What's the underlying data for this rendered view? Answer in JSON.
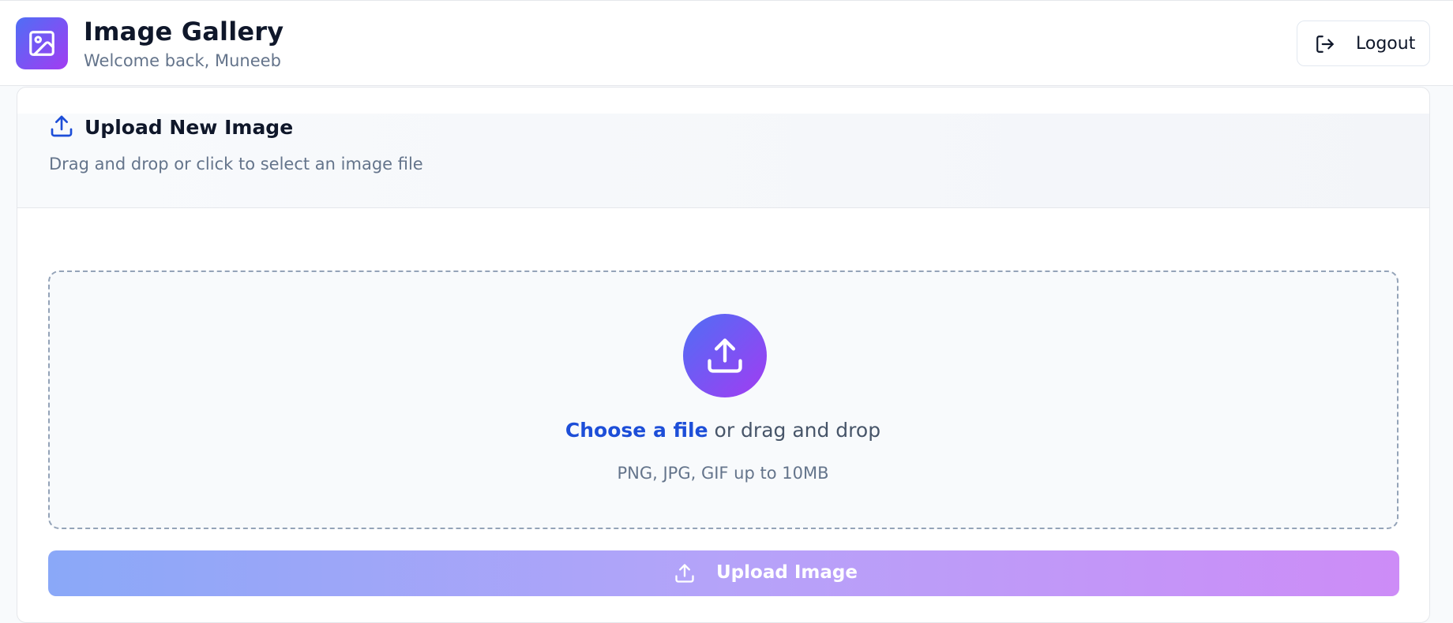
{
  "header": {
    "title": "Image Gallery",
    "subtitle": "Welcome back, Muneeb",
    "logo_icon": "image-icon",
    "logout_label": "Logout",
    "logout_icon": "logout-icon"
  },
  "upload_card": {
    "title": "Upload New Image",
    "title_icon": "upload-icon",
    "description": "Drag and drop or click to select an image file",
    "dropzone": {
      "icon": "upload-icon",
      "choose_link": "Choose a file",
      "choose_rest": " or drag and drop",
      "hint": "PNG, JPG, GIF up to 10MB"
    },
    "upload_button": {
      "label": "Upload Image",
      "icon": "upload-icon"
    }
  },
  "colors": {
    "accent_blue": "#1d4ed8",
    "gradient_start": "#4f6ef5",
    "gradient_end": "#a23cf2"
  }
}
